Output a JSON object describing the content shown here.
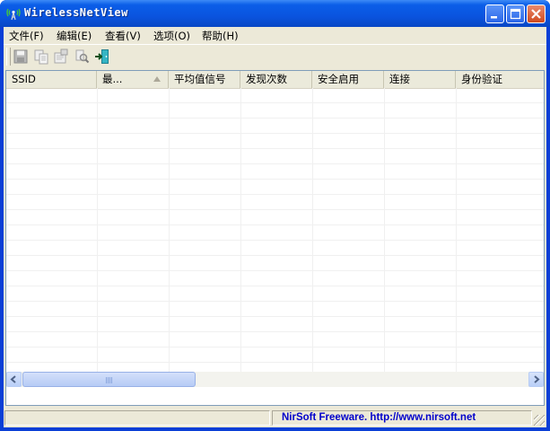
{
  "window": {
    "title": "WirelessNetView"
  },
  "menu": {
    "items": [
      "文件(F)",
      "编辑(E)",
      "查看(V)",
      "选项(O)",
      "帮助(H)"
    ]
  },
  "toolbar": {
    "icons": [
      "save-icon",
      "copy-icon",
      "properties-icon",
      "find-icon",
      "exit-icon"
    ]
  },
  "list": {
    "columns": [
      "SSID",
      "最...",
      "平均值信号",
      "发现次数",
      "安全启用",
      "连接",
      "身份验证"
    ],
    "sorted_column_index": 1
  },
  "status": {
    "left_text": "",
    "right_text": "NirSoft Freeware.  http://www.nirsoft.net"
  },
  "colors": {
    "title_bar": "#0a54df",
    "link": "#0000cc",
    "window_bg": "#ece9d8"
  }
}
